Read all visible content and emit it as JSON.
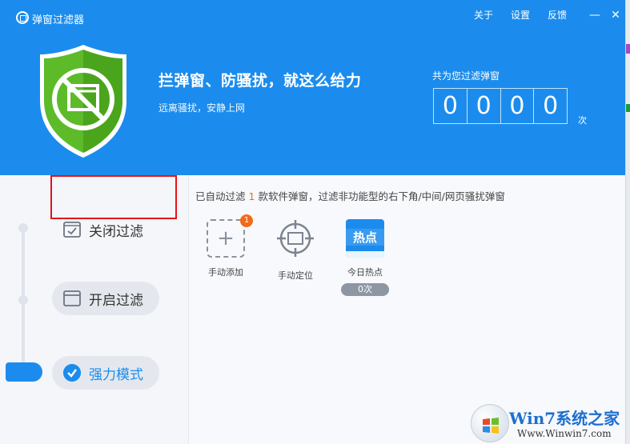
{
  "window": {
    "title": "弹窗过滤器",
    "nav": {
      "about": "关于",
      "settings": "设置",
      "feedback": "反馈"
    },
    "controls": {
      "minimize": "—",
      "close": "✕"
    }
  },
  "hero": {
    "slogan": "拦弹窗、防骚扰，就这么给力",
    "subslogan": "远离骚扰，安静上网"
  },
  "counter": {
    "label": "共为您过滤弹窗",
    "digits": [
      "0",
      "0",
      "0",
      "0"
    ],
    "unit": "次"
  },
  "sidebar": {
    "modes": [
      {
        "label": "关闭过滤",
        "selected": false
      },
      {
        "label": "开启过滤",
        "selected": false
      },
      {
        "label": "强力模式",
        "selected": true
      }
    ]
  },
  "content": {
    "status_prefix": "已自动过滤",
    "status_count": "1",
    "status_suffix": "款软件弹窗，过滤非功能型的右下角/中间/网页骚扰弹窗",
    "tools": [
      {
        "label": "手动添加",
        "badge": "1",
        "icon": "dashed-plus-icon"
      },
      {
        "label": "手动定位",
        "icon": "crosshair-icon"
      },
      {
        "label": "今日热点",
        "icon": "hot-news-icon",
        "tile_text": "热点",
        "pill": "0次"
      }
    ]
  },
  "watermark": {
    "title": "Win7系统之家",
    "url": "Www.Winwin7.com"
  },
  "colors": {
    "header_blue": "#1b8ced",
    "shield_green": "#5dbb2a",
    "accent_orange": "#f26a1b",
    "highlight_red": "#e5111a"
  }
}
